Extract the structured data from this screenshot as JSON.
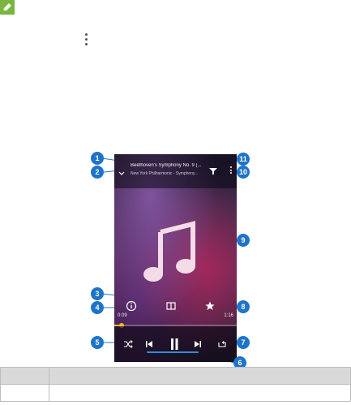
{
  "phone": {
    "song_title": "Beethoven's Symphony No. 9 (...",
    "song_artist": "New York Philharmonic - Symphony...",
    "time_elapsed": "0:09",
    "time_total": "1:16",
    "progress_fraction": 0.06
  },
  "callouts": {
    "c1": "1",
    "c2": "2",
    "c3": "3",
    "c4": "4",
    "c5": "5",
    "c6": "6",
    "c7": "7",
    "c8": "8",
    "c9": "9",
    "c10": "10",
    "c11": "11"
  },
  "table": {
    "header": [
      "",
      ""
    ],
    "row1": [
      "",
      ""
    ]
  },
  "colors": {
    "callout": "#1d74c9",
    "progress": "#f3b935",
    "note_icon_bg": "#79b540"
  }
}
